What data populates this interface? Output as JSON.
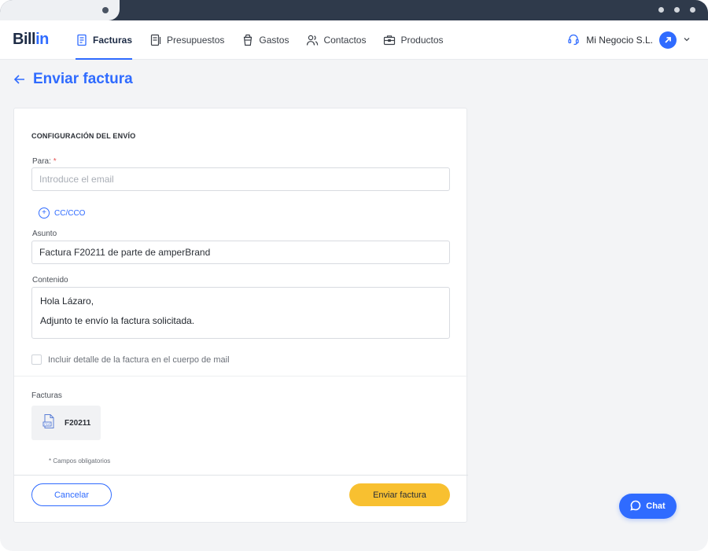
{
  "app": {
    "logo_text": "Bill",
    "logo_accent": "in"
  },
  "nav": {
    "items": [
      {
        "label": "Facturas",
        "icon": "invoice-icon",
        "active": true
      },
      {
        "label": "Presupuestos",
        "icon": "quote-icon",
        "active": false
      },
      {
        "label": "Gastos",
        "icon": "cup-icon",
        "active": false
      },
      {
        "label": "Contactos",
        "icon": "contacts-icon",
        "active": false
      },
      {
        "label": "Productos",
        "icon": "briefcase-icon",
        "active": false
      }
    ]
  },
  "account": {
    "name": "Mi Negocio S.L.",
    "support_icon": "headset-icon",
    "avatar_icon": "arrow-up-right-icon",
    "menu_icon": "chevron-down-icon"
  },
  "page": {
    "title": "Enviar factura",
    "back_icon": "arrow-left-icon"
  },
  "form": {
    "section_title": "CONFIGURACIÓN DEL ENVÍO",
    "to_label": "Para:",
    "to_required_mark": "*",
    "to_placeholder": "Introduce el email",
    "to_value": "",
    "cc_label": "CC/CCO",
    "subject_label": "Asunto",
    "subject_value": "Factura F20211 de parte de amperBrand",
    "content_label": "Contenido",
    "content_lines": [
      "Hola Lázaro,",
      "Adjunto te envío la factura solicitada."
    ],
    "include_detail_label": "Incluir detalle de la factura en el cuerpo de mail",
    "include_detail_checked": false,
    "invoices_label": "Facturas",
    "invoice_file": "F20211",
    "invoice_file_icon": "pdf-file-icon",
    "required_note": "* Campos obligatorios"
  },
  "actions": {
    "cancel_label": "Cancelar",
    "send_label": "Enviar factura"
  },
  "chat": {
    "label": "Chat",
    "icon": "chat-bubble-icon"
  },
  "colors": {
    "accent": "#2f6bff",
    "send_button": "#f8c030",
    "chrome": "#2f3a4b"
  }
}
